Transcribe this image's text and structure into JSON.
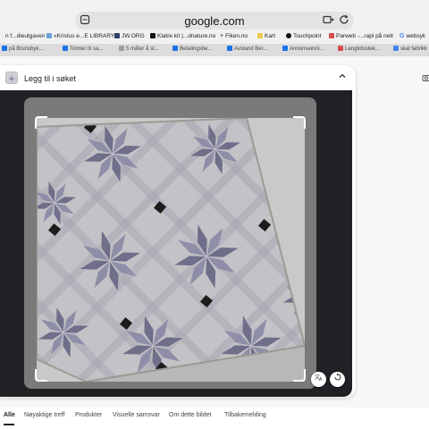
{
  "browser": {
    "url": "google.com"
  },
  "bookmarks": [
    {
      "label": "n f...dieutgaven",
      "color": "#ffffff"
    },
    {
      "label": "«Kristus e...E LIBRARY",
      "color": "#6aa0d8"
    },
    {
      "label": "JW.ORG",
      "color": "#2b3f6b"
    },
    {
      "label": "Klatre kit |...dnature.no",
      "color": "#111111"
    },
    {
      "label": "Fiken.no",
      "color": "#ffffff"
    },
    {
      "label": "Kart",
      "color": "#f2c94c"
    },
    {
      "label": "Touchpoint",
      "color": "#111111"
    },
    {
      "label": "Parweb -...rapi på nett",
      "color": "#d94c4c"
    },
    {
      "label": "websyk",
      "color": "#4285f4"
    }
  ],
  "tabs": [
    {
      "label": "på Brunsbyk...",
      "color": "#1a73e8"
    },
    {
      "label": "Tomter til sa...",
      "color": "#1a73e8"
    },
    {
      "label": "5 måter å st...",
      "color": "#9aa0a6"
    },
    {
      "label": "Betalingsbe...",
      "color": "#1a73e8"
    },
    {
      "label": "Avstand Ber...",
      "color": "#1a73e8"
    },
    {
      "label": "Annonseinnl...",
      "color": "#1a73e8"
    },
    {
      "label": "Langtidsstek...",
      "color": "#d94c4c"
    },
    {
      "label": "skal fabrikk",
      "color": "#4285f4"
    }
  ],
  "lens": {
    "title": "Legg til i søket"
  },
  "tile": {
    "base": "#c4c2c6",
    "star": "#8e8ea8",
    "star_dark": "#6f6f8a",
    "band": "#a9a7b3",
    "dot": "#1c1c1c"
  },
  "nav_tabs": [
    {
      "label": "Alle",
      "active": true
    },
    {
      "label": "Nøyaktige treff",
      "active": false
    },
    {
      "label": "Produkter",
      "active": false
    },
    {
      "label": "Visuelle samsvar",
      "active": false
    },
    {
      "label": "Om dette bildet",
      "active": false
    },
    {
      "label": "Tilbakemelding",
      "active": false
    }
  ],
  "icons": {
    "tabs": "tabs-icon",
    "share": "share-icon",
    "reload": "reload-icon",
    "expand": "chevron-up-icon",
    "translate": "translate-icon",
    "rotate": "rotate-icon",
    "camera": "camera-icon"
  }
}
